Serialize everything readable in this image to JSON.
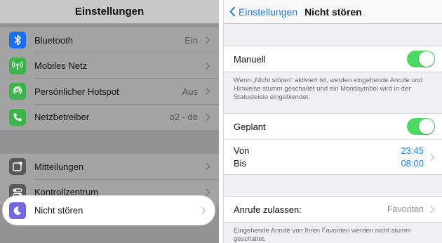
{
  "colors": {
    "accent": "#1c7cf0",
    "toggle_on": "#4cd964",
    "bluetooth_icon": "#1a6ff0",
    "mobile_icon": "#3bb54a",
    "hotspot_icon": "#3bb54a",
    "carrier_icon": "#3bb54a",
    "notifications_icon": "#5a5a5a",
    "control_icon": "#5a5a5a",
    "dnd_icon": "#7468df"
  },
  "left": {
    "title": "Einstellungen",
    "group1": [
      {
        "label": "Bluetooth",
        "value": "Ein",
        "icon": "bluetooth-icon"
      },
      {
        "label": "Mobiles Netz",
        "value": "",
        "icon": "cellular-icon"
      },
      {
        "label": "Persönlicher Hotspot",
        "value": "Aus",
        "icon": "hotspot-icon"
      },
      {
        "label": "Netzbetreiber",
        "value": "o2 - de",
        "icon": "phone-icon"
      }
    ],
    "group2": [
      {
        "label": "Mitteilungen",
        "icon": "notifications-icon"
      },
      {
        "label": "Kontrollzentrum",
        "icon": "control-center-icon"
      }
    ],
    "highlighted": {
      "label": "Nicht stören",
      "icon": "moon-icon"
    }
  },
  "right": {
    "back_label": "Einstellungen",
    "title": "Nicht stören",
    "manual": {
      "label": "Manuell",
      "on": true
    },
    "manual_note": "Wenn „Nicht stören“ aktiviert ist, werden eingehende Anrufe und Hinweise stumm geschaltet und ein Mondsymbol wird in der Statusleiste eingeblendet.",
    "scheduled": {
      "label": "Geplant",
      "on": true
    },
    "from_label": "Von",
    "to_label": "Bis",
    "from_time": "23:45",
    "to_time": "08:00",
    "allow_calls": {
      "label": "Anrufe zulassen:",
      "value": "Favoriten"
    },
    "calls_note": "Eingehende Anrufe von Ihren Favoriten werden nicht stumm geschaltet."
  }
}
